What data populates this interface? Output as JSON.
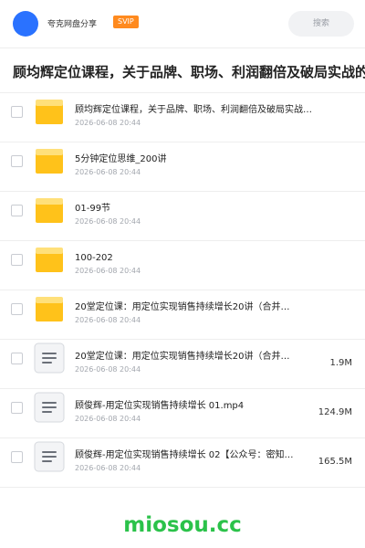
{
  "header": {
    "app_title": "夸克网盘分享",
    "badge": "SVIP",
    "search_label": "搜索"
  },
  "share_title": "顾均辉定位课程，关于品牌、职场、利润翻倍及破局实战的",
  "files": [
    {
      "type": "folder",
      "name": "顾均辉定位课程，关于品牌、职场、利润翻倍及破局实战…",
      "date": "2026-06-08 20:44",
      "size": ""
    },
    {
      "type": "folder",
      "name": "5分钟定位思维_200讲",
      "date": "2026-06-08 20:44",
      "size": ""
    },
    {
      "type": "folder",
      "name": "01-99节",
      "date": "2026-06-08 20:44",
      "size": ""
    },
    {
      "type": "folder",
      "name": "100-202",
      "date": "2026-06-08 20:44",
      "size": ""
    },
    {
      "type": "folder",
      "name": "20堂定位课：用定位实现销售持续增长20讲（合并…",
      "date": "2026-06-08 20:44",
      "size": ""
    },
    {
      "type": "doc",
      "name": "20堂定位课：用定位实现销售持续增长20讲（合并…",
      "date": "2026-06-08 20:44",
      "size": "1.9M"
    },
    {
      "type": "doc",
      "name": "顾俊辉-用定位实现销售持续增长 01.mp4",
      "date": "2026-06-08 20:44",
      "size": "124.9M"
    },
    {
      "type": "doc",
      "name": "顾俊辉-用定位实现销售持续增长 02【公众号：密知…",
      "date": "2026-06-08 20:44",
      "size": "165.5M"
    }
  ],
  "watermark": "miosou.cc",
  "colors": {
    "accent": "#2a72ff",
    "badge": "#ff8a1e",
    "folder": "#ffc21a",
    "watermark": "#2bc24a"
  }
}
